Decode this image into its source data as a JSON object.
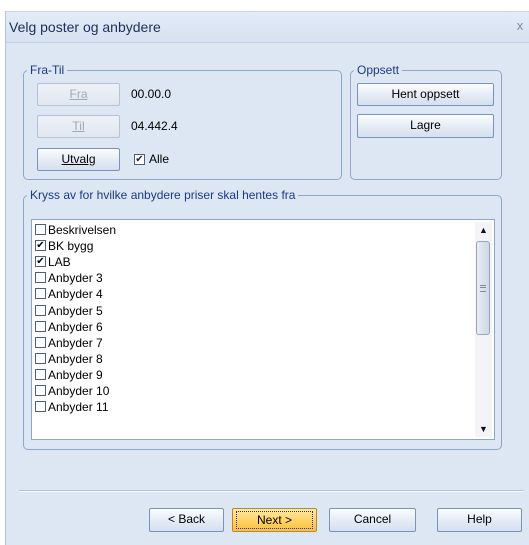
{
  "window": {
    "title": "Velg poster og anbydere",
    "close_glyph": "x"
  },
  "fra_til": {
    "legend": "Fra-Til",
    "fra_button": "Fra",
    "til_button": "Til",
    "fra_value": "00.00.0",
    "til_value": "04.442.4",
    "utvalg_button": "Utvalg",
    "alle_label": "Alle",
    "alle_checked": true
  },
  "oppsett": {
    "legend": "Oppsett",
    "hent_button": "Hent oppsett",
    "lagre_button": "Lagre"
  },
  "bidders": {
    "legend": "Kryss av for hvilke anbydere priser skal hentes fra",
    "items": [
      {
        "label": "Beskrivelsen",
        "checked": false
      },
      {
        "label": "BK bygg",
        "checked": true
      },
      {
        "label": "LAB",
        "checked": true
      },
      {
        "label": "Anbyder 3",
        "checked": false
      },
      {
        "label": "Anbyder 4",
        "checked": false
      },
      {
        "label": "Anbyder 5",
        "checked": false
      },
      {
        "label": "Anbyder 6",
        "checked": false
      },
      {
        "label": "Anbyder 7",
        "checked": false
      },
      {
        "label": "Anbyder 8",
        "checked": false
      },
      {
        "label": "Anbyder 9",
        "checked": false
      },
      {
        "label": "Anbyder 10",
        "checked": false
      },
      {
        "label": "Anbyder 11",
        "checked": false
      }
    ]
  },
  "footer": {
    "back_button": "< Back",
    "next_button": "Next >",
    "cancel_button": "Cancel",
    "help_button": "Help"
  },
  "colors": {
    "dialog_bg": "#dde6f3",
    "legend_text": "#1b3a84",
    "default_button": "#ffd261"
  }
}
